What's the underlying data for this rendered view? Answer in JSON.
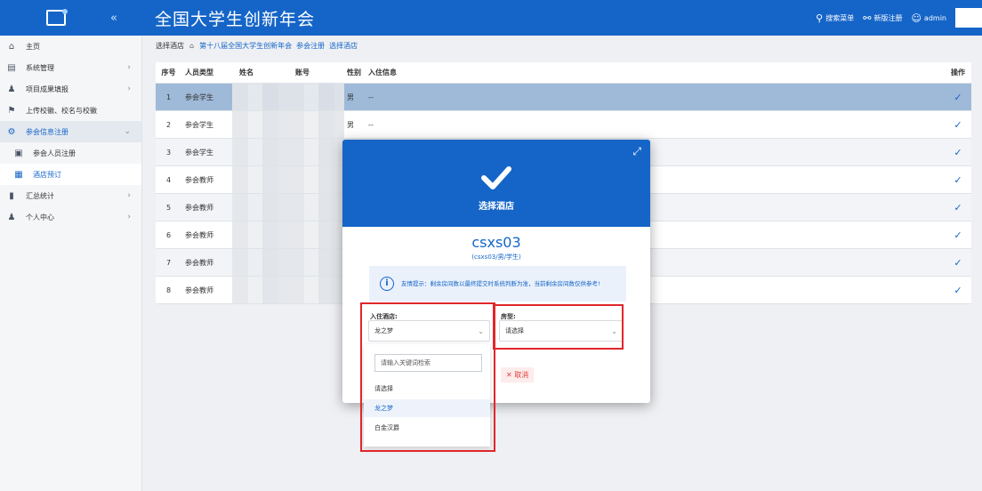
{
  "header": {
    "title": "全国大学生创新年会",
    "collapse_glyph": "«",
    "links": [
      {
        "icon": "search-icon",
        "glyph": "⚲",
        "label": "搜索菜单"
      },
      {
        "icon": "link-icon",
        "glyph": "⚲",
        "label": "新版注册"
      },
      {
        "icon": "user-icon",
        "glyph": "⚲",
        "label": "admin"
      }
    ]
  },
  "sidebar": {
    "items": [
      {
        "label": "主页",
        "glyph": "⌂",
        "chevron": ""
      },
      {
        "label": "系统管理",
        "glyph": "▤",
        "chevron": "›"
      },
      {
        "label": "项目成果填报",
        "glyph": "♟",
        "chevron": "›"
      },
      {
        "label": "上传校徽、校名与校徽",
        "glyph": "⚑",
        "chevron": ""
      },
      {
        "label": "参会信息注册",
        "glyph": "⚙",
        "chevron": "⌄"
      },
      {
        "label": "参会人员注册",
        "glyph": "▣",
        "chevron": ""
      },
      {
        "label": "酒店预订",
        "glyph": "▦",
        "chevron": ""
      },
      {
        "label": "汇总统计",
        "glyph": "▮",
        "chevron": "›"
      },
      {
        "label": "个人中心",
        "glyph": "♟",
        "chevron": "›"
      }
    ]
  },
  "breadcrumb": {
    "first": "选择酒店",
    "home_glyph": "⌂",
    "items": [
      "第十八届全国大学生创新年会",
      "参会注册",
      "选择酒店"
    ]
  },
  "table": {
    "headers": {
      "no": "序号",
      "type": "人员类型",
      "name": "姓名",
      "account": "账号",
      "gender": "性别",
      "info": "入住信息",
      "op": "操作"
    },
    "rows": [
      {
        "no": "1",
        "type": "参会学生",
        "gender": "男",
        "info": "--"
      },
      {
        "no": "2",
        "type": "参会学生",
        "gender": "男",
        "info": "--"
      },
      {
        "no": "3",
        "type": "参会学生",
        "gender": "",
        "info": ""
      },
      {
        "no": "4",
        "type": "参会教师",
        "gender": "",
        "info": ""
      },
      {
        "no": "5",
        "type": "参会教师",
        "gender": "",
        "info": ""
      },
      {
        "no": "6",
        "type": "参会教师",
        "gender": "",
        "info": ""
      },
      {
        "no": "7",
        "type": "参会教师",
        "gender": "",
        "info": ""
      },
      {
        "no": "8",
        "type": "参会教师",
        "gender": "",
        "info": ""
      }
    ],
    "check_glyph": "✓"
  },
  "modal": {
    "title": "选择酒店",
    "close_glyph": "⤢",
    "user": "csxs03",
    "user_detail": "(csxs03/男/学生)",
    "tip_glyph": "i",
    "tip_text": "友情提示：剩余房间数以最终提交时系统判断为准，当前剩余房间数仅供参考!",
    "hotel_label": "入住酒店:",
    "hotel_value": "龙之梦",
    "room_label": "房型:",
    "room_value": "请选择",
    "arrow_glyph": "⌄",
    "cancel_label": "✕ 取消"
  },
  "dropdown": {
    "search_placeholder": "请输入关键词检索",
    "options": [
      "请选择",
      "龙之梦",
      "白金汉爵"
    ],
    "selected": "龙之梦"
  },
  "colors": {
    "primary": "#1565c8",
    "highlight": "#e0262b",
    "selected_row": "#9fb9d8"
  }
}
